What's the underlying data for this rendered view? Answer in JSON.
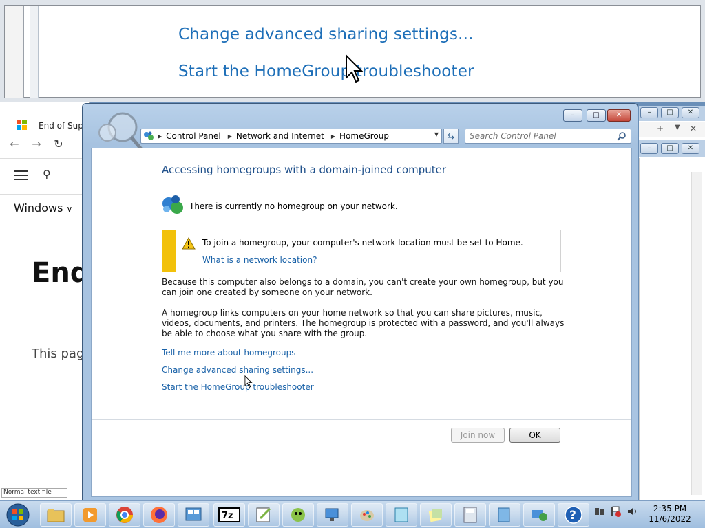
{
  "zoom": {
    "links": [
      "Change advanced sharing settings...",
      "Start the HomeGroup troubleshooter"
    ]
  },
  "edge_window": {
    "tab_title": "End of Suppor",
    "nav_dropdown": "Windows",
    "heading": "End",
    "body_text": "This pag",
    "status_text": "Normal text file"
  },
  "window": {
    "address": {
      "crumbs": [
        "Control Panel",
        "Network and Internet",
        "HomeGroup"
      ]
    },
    "search": {
      "placeholder": "Search Control Panel"
    },
    "caption_buttons": {
      "minimize": "–",
      "maximize": "□",
      "close": "✕"
    },
    "content": {
      "title": "Accessing homegroups with a domain-joined computer",
      "status": "There is currently no homegroup on your network.",
      "warning": {
        "text": "To join a homegroup, your computer's network location must be set to Home.",
        "link": "What is a network location?"
      },
      "para1": "Because this computer also belongs to a domain, you can't create your own homegroup, but you can join one created by someone on your network.",
      "para2": "A homegroup links computers on your home network so that you can share pictures, music, videos, documents, and printers. The homegroup is protected with a password, and you'll always be able to choose what you share with the group.",
      "links": {
        "tell_more": "Tell me more about homegroups",
        "advanced": "Change advanced sharing settings...",
        "troubleshooter": "Start the HomeGroup troubleshooter"
      }
    },
    "buttons": {
      "join": "Join now",
      "ok": "OK"
    }
  },
  "taskbar": {
    "apps": [
      "Windows Explorer",
      "Windows Media Center",
      "Google Chrome",
      "Firefox",
      "Control Panel",
      "7-Zip",
      "Notepad++",
      "Task Scheduler",
      "Remote Desktop",
      "Paint",
      "Notepad",
      "Sticky Notes",
      "Calculator",
      "Windows Update",
      "Network",
      "Help"
    ],
    "clock": {
      "time": "2:35 PM",
      "date": "11/6/2022"
    }
  },
  "colors": {
    "link": "#1a62a8",
    "title": "#1e4f8a",
    "warning_bar": "#f2c10a"
  }
}
